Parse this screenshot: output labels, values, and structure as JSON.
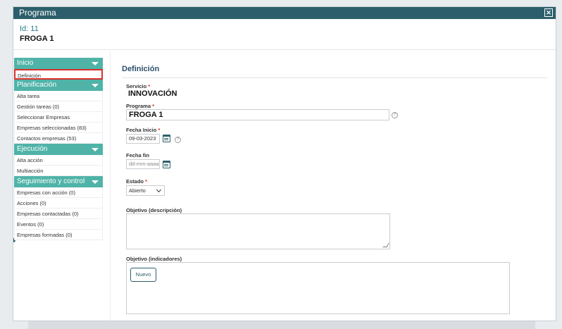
{
  "window": {
    "title": "Programa",
    "close_icon": "close-icon"
  },
  "header": {
    "id_text": "Id: 11",
    "name": "FROGA 1"
  },
  "sidebar": {
    "sections": [
      {
        "label": "Inicio",
        "items": [
          "Definición"
        ]
      },
      {
        "label": "Planificación",
        "items": [
          "Alta tarea",
          "Gestión tareas (0)",
          "Seleccionar Empresas",
          "Empresas seleccionadas (83)",
          "Contactos empresas (53)"
        ]
      },
      {
        "label": "Ejecución",
        "items": [
          "Alta acción",
          "Multiacción"
        ]
      },
      {
        "label": "Seguimiento y control",
        "items": [
          "Empresas con acción (0)",
          "Acciones (0)",
          "Empresas contactadas (0)",
          "Eventos (0)",
          "Empresas formadas (0)"
        ]
      }
    ],
    "active_item": "Definición"
  },
  "main": {
    "title": "Definición",
    "servicio": {
      "label": "Servicio",
      "value": "INNOVACIÓN"
    },
    "programa": {
      "label": "Programa",
      "value": "FROGA 1"
    },
    "fecha_inicio": {
      "label": "Fecha Inicio",
      "value": "09-03-2023"
    },
    "fecha_fin": {
      "label": "Fecha fin",
      "placeholder": "dd-mm-aaaa"
    },
    "estado": {
      "label": "Estado",
      "value": "Abierto"
    },
    "objetivo_desc": {
      "label": "Objetivo (descripción)",
      "value": ""
    },
    "objetivo_ind": {
      "label": "Objetivo (indicadores)",
      "button": "Nuevo"
    },
    "required_mark": "*",
    "help_glyph": "?"
  },
  "colors": {
    "titlebar": "#2c5f6b",
    "section": "#4fb3a8",
    "active_outline": "#d9302b",
    "accent_text": "#2f7f8a"
  }
}
